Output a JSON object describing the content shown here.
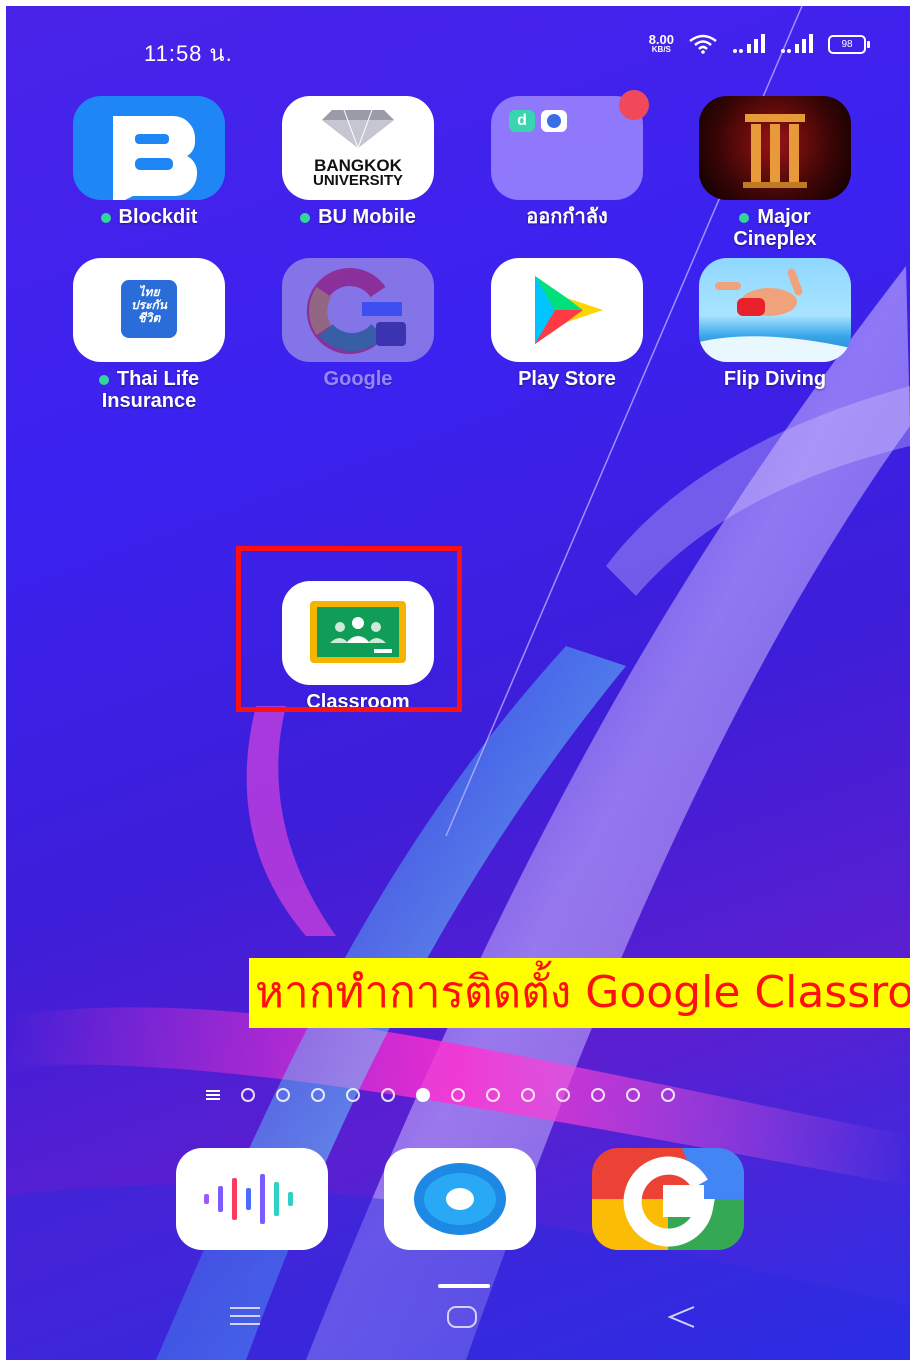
{
  "status_bar": {
    "time": "11:58 น.",
    "net_speed_value": "8.00",
    "net_speed_unit": "KB/S",
    "battery": "98",
    "icons": [
      "wifi-icon",
      "signal-icon",
      "signal-icon",
      "battery-icon"
    ]
  },
  "apps": [
    {
      "label": "Blockdit",
      "new_dot": true,
      "icon": "blockdit-icon"
    },
    {
      "label": "BU Mobile",
      "new_dot": true,
      "icon": "bu-mobile-icon",
      "icon_text_1": "BANGKOK",
      "icon_text_2": "UNIVERSITY"
    },
    {
      "label": "ออกกำลัง",
      "new_dot": false,
      "icon": "folder-icon"
    },
    {
      "label_line1": "Major",
      "label_line2": "Cineplex",
      "new_dot": true,
      "icon": "major-cineplex-icon"
    },
    {
      "label_line1": "Thai Life",
      "label_line2": "Insurance",
      "new_dot": true,
      "icon": "thai-life-icon",
      "icon_text": "ไทย ประกัน ชีวิต"
    },
    {
      "label": "Google",
      "new_dot": false,
      "icon": "google-workspace-icon"
    },
    {
      "label": "Play Store",
      "new_dot": false,
      "icon": "play-store-icon"
    },
    {
      "label": "Flip Diving",
      "new_dot": false,
      "icon": "flip-diving-icon"
    },
    {
      "label": "Classroom",
      "new_dot": false,
      "icon": "google-classroom-icon"
    }
  ],
  "banner_text": "หากทำการติดตั้ง Google Classro",
  "pager": {
    "page_count": 13,
    "active_index": 5
  },
  "dock": [
    "voice-recorder-icon",
    "browser-icon",
    "google-icon"
  ],
  "colors": {
    "highlight": "#ff1010",
    "banner_bg": "#ffff00",
    "banner_text": "#ff1010",
    "badge": "#f04a5a",
    "new_dot": "#33d69a"
  }
}
